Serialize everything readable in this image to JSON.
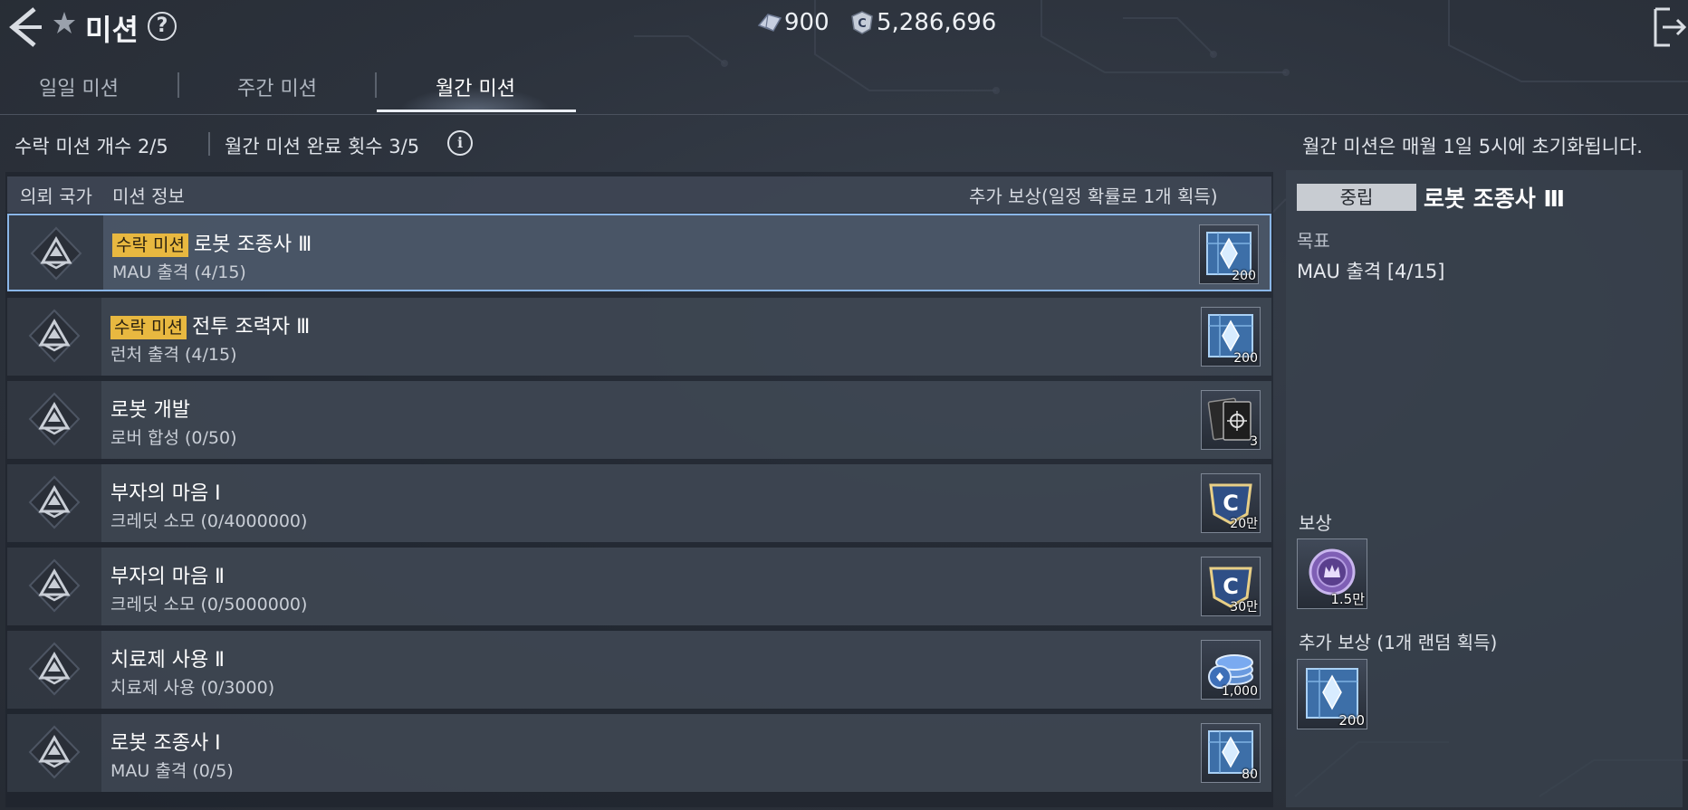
{
  "header": {
    "title": "미션",
    "back_icon": "back-arrow-icon",
    "help_label": "?",
    "exit_icon": "exit-icon"
  },
  "currency": {
    "gem_value": "900",
    "credit_value": "5,286,696"
  },
  "tabs": [
    {
      "label": "일일 미션",
      "active": false
    },
    {
      "label": "주간 미션",
      "active": false
    },
    {
      "label": "월간 미션",
      "active": true
    }
  ],
  "info": {
    "accepted_count": "수락 미션 개수 2/5",
    "monthly_complete": "월간 미션 완료 횟수 3/5",
    "info_label": "i",
    "reset_note": "월간 미션은 매월 1일 5시에 초기화됩니다."
  },
  "list": {
    "headers": {
      "country": "의뢰 국가",
      "info": "미션 정보",
      "bonus": "추가 보상(일정 확률로 1개 획득)"
    },
    "rows": [
      {
        "badge": "수락 미션",
        "title": "로봇 조종사 Ⅲ",
        "sub": "MAU 출격 (4/15)",
        "reward_icon": "crystal-box-icon",
        "reward_qty": "200",
        "selected": true
      },
      {
        "badge": "수락 미션",
        "title": "전투 조력자 Ⅲ",
        "sub": "런처 출격 (4/15)",
        "reward_icon": "crystal-box-icon",
        "reward_qty": "200",
        "selected": false
      },
      {
        "badge": "",
        "title": "로봇 개발",
        "sub": "로버 합성 (0/50)",
        "reward_icon": "card-pack-icon",
        "reward_qty": "3",
        "selected": false
      },
      {
        "badge": "",
        "title": "부자의 마음 Ⅰ",
        "sub": "크레딧 소모 (0/4000000)",
        "reward_icon": "credit-badge-icon",
        "reward_qty": "20만",
        "selected": false
      },
      {
        "badge": "",
        "title": "부자의 마음 Ⅱ",
        "sub": "크레딧 소모 (0/5000000)",
        "reward_icon": "credit-badge-icon",
        "reward_qty": "30만",
        "selected": false
      },
      {
        "badge": "",
        "title": "치료제 사용 Ⅱ",
        "sub": "치료제 사용 (0/3000)",
        "reward_icon": "coin-stack-icon",
        "reward_qty": "1,000",
        "selected": false
      },
      {
        "badge": "",
        "title": "로봇 조종사 Ⅰ",
        "sub": "MAU 출격 (0/5)",
        "reward_icon": "crystal-box-icon",
        "reward_qty": "80",
        "selected": false
      }
    ]
  },
  "detail": {
    "camp": "중립",
    "title": "로봇 조종사 Ⅲ",
    "goal_label": "목표",
    "goal_value": "MAU 출격 [4/15]",
    "reward_label": "보상",
    "reward_qty": "1.5만",
    "bonus_label": "추가 보상 (1개 랜덤 획득)",
    "bonus_qty": "200"
  },
  "colors": {
    "badge": "#e8b840",
    "selected_border": "#8ab6e8",
    "camp_tag": "#c8ccd2"
  }
}
